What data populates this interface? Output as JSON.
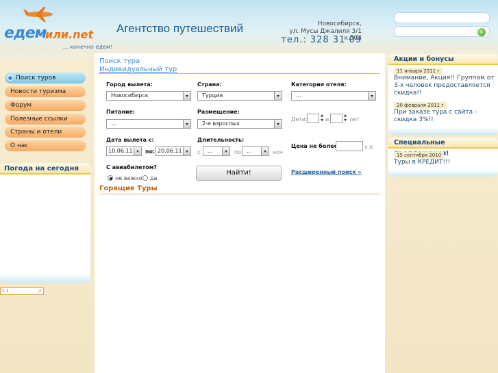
{
  "header": {
    "logo_brand": "едем",
    "logo_brand2": "или.net",
    "logo_slogan": "... конечно едем!",
    "agency_title": "Агентство путешествий",
    "city": "Новосибирск,",
    "address": "ул. Мусы Джалиля 3/1 к.504",
    "phone": "тел.: 328 31 09",
    "go_label": "»"
  },
  "nav": {
    "items": [
      {
        "label": "Поиск туров"
      },
      {
        "label": "Новости туризма"
      },
      {
        "label": "Форум"
      },
      {
        "label": "Полезные ссылки"
      },
      {
        "label": "Страны и отели"
      },
      {
        "label": "О нас"
      }
    ],
    "weather_title": "Погода на сегодня",
    "counter_text": "1.1"
  },
  "main": {
    "search_tour_link": "Поиск тура",
    "individual_tour_link": "Индивидуальный тур",
    "departure_city": {
      "label": "Город вылета:",
      "value": "Новосибирск"
    },
    "country": {
      "label": "Страна:",
      "value": "Турция"
    },
    "hotel_category": {
      "label": "Категория отеля:",
      "value": "..."
    },
    "meals": {
      "label": "Питание:",
      "value": "..."
    },
    "accommodation": {
      "label": "Размещение:",
      "value": "2-е взрослых"
    },
    "children": {
      "label": "Дети:",
      "and_label": "и",
      "years_label": "лет"
    },
    "departure_date": {
      "label": "Дата вылета с:",
      "from": "10.06.11",
      "to_label": "по:",
      "to": "20.06.11"
    },
    "duration": {
      "label": "Длительность:",
      "from_label": "с",
      "from": "...",
      "to_label": "по",
      "to": "...",
      "unit": "ноч"
    },
    "price": {
      "label": "Цена не более:",
      "unit": "у.е."
    },
    "with_flight": {
      "label": "С авиабилетом?",
      "opt1": "не важно",
      "opt2": "да"
    },
    "search_button": "Найти!",
    "advanced_link": "Расширенный поиск »",
    "hot_tours_title": "Горящие Туры"
  },
  "sidebar": {
    "promo_title": "Акции и бонусы",
    "promo_items": [
      {
        "date": "11 января 2011 г",
        "text": "Внимание, Акция!! Группам от 3-х человек предоставляется скидка!!"
      },
      {
        "date": "20 февраля 2011 г",
        "text": "При заказе тура с сайта - скидка 3%!!"
      }
    ],
    "special_title": "Специальные предложения!",
    "special_items": [
      {
        "date": "15 сентября 2010",
        "text": "Туры в КРЕДИТ!!!"
      }
    ]
  }
}
